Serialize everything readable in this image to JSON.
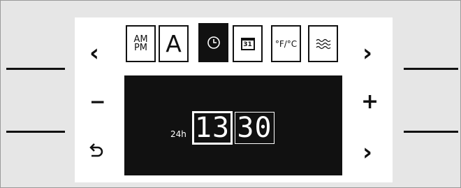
{
  "controls": {
    "left_top_arrow": "‹",
    "left_minus": "−",
    "left_back": "↺",
    "right_top_arrow": "›",
    "right_plus": "+",
    "right_bottom_arrow": "›"
  },
  "tabs": [
    {
      "label": "AM\nPM",
      "name": "am-pm"
    },
    {
      "label": "A",
      "name": "display-font"
    },
    {
      "label": "",
      "name": "clock"
    },
    {
      "label": "31",
      "name": "calendar"
    },
    {
      "label": "°F/°C",
      "name": "temperature-unit"
    },
    {
      "label": "",
      "name": "waves"
    }
  ],
  "display": {
    "mode": "24h",
    "hours": "13",
    "minutes": "30"
  },
  "colors": {
    "background": "#e6e6e6",
    "panel": "#ffffff",
    "screen": "#111111"
  }
}
